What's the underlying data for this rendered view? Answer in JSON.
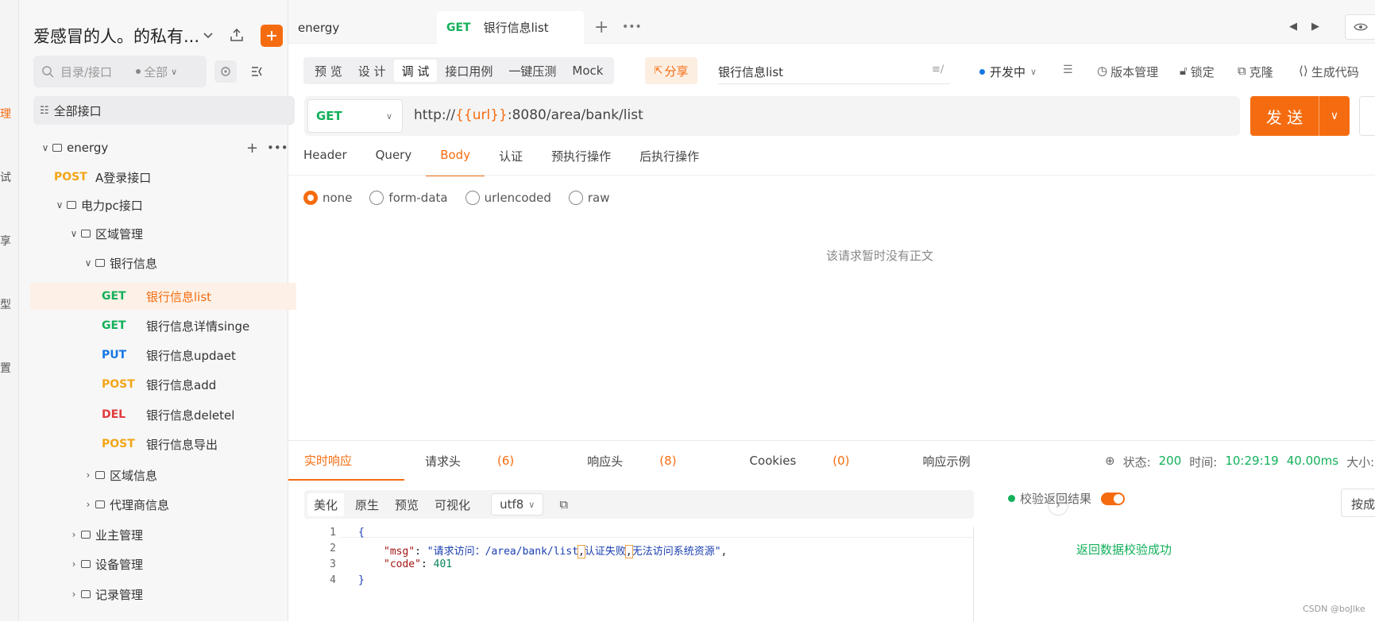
{
  "left_rail": {
    "items": [
      "理",
      "试",
      "享",
      "型",
      "置"
    ]
  },
  "sidebar": {
    "workspace": "爱感冒的人。的私有...",
    "search_placeholder": "目录/接口",
    "scope": "全部",
    "all_apis": "全部接口",
    "tree": [
      {
        "label": "energy",
        "type": "project"
      },
      {
        "method": "POST",
        "label": "A登录接口"
      },
      {
        "label": "电力pc接口",
        "type": "folder"
      },
      {
        "label": "区域管理",
        "type": "folder"
      },
      {
        "label": "银行信息",
        "type": "folder"
      },
      {
        "method": "GET",
        "label": "银行信息list",
        "selected": true
      },
      {
        "method": "GET",
        "label": "银行信息详情singe"
      },
      {
        "method": "PUT",
        "label": "银行信息updaet"
      },
      {
        "method": "POST",
        "label": "银行信息add"
      },
      {
        "method": "DEL",
        "label": "银行信息deletel"
      },
      {
        "method": "POST",
        "label": "银行信息导出"
      },
      {
        "label": "区域信息",
        "type": "folder"
      },
      {
        "label": "代理商信息",
        "type": "folder"
      },
      {
        "label": "业主管理",
        "type": "folder"
      },
      {
        "label": "设备管理",
        "type": "folder"
      },
      {
        "label": "记录管理",
        "type": "folder"
      }
    ]
  },
  "tabs": [
    {
      "label": "energy"
    },
    {
      "method": "GET",
      "label": "银行信息list",
      "active": true
    }
  ],
  "toolbar": {
    "modes": [
      "预 览",
      "设 计",
      "调 试",
      "接口用例",
      "一键压测",
      "Mock"
    ],
    "active_mode": "调 试",
    "share": "分享",
    "api_name": "银行信息list",
    "status": "开发中",
    "version": "版本管理",
    "lock": "锁定",
    "clone": "克隆",
    "gencode": "生成代码"
  },
  "request": {
    "method": "GET",
    "url_prefix": "http://",
    "url_var": "{{url}}",
    "url_suffix": ":8080/area/bank/list",
    "send": "发 送",
    "tabs": [
      "Header",
      "Query",
      "Body",
      "认证",
      "预执行操作",
      "后执行操作"
    ],
    "active_tab": "Body",
    "body_types": [
      "none",
      "form-data",
      "urlencoded",
      "raw"
    ],
    "body_selected": "none",
    "empty_body": "该请求暂时没有正文"
  },
  "response": {
    "tabs": [
      {
        "label": "实时响应",
        "count": ""
      },
      {
        "label": "请求头",
        "count": "(6)"
      },
      {
        "label": "响应头",
        "count": "(8)"
      },
      {
        "label": "Cookies",
        "count": "(0)"
      },
      {
        "label": "响应示例",
        "count": ""
      }
    ],
    "status_label": "状态:",
    "status_code": "200",
    "time_label": "时间:",
    "time_value": "10:29:19",
    "duration": "40.00ms",
    "size_label": "大小:",
    "formats": [
      "美化",
      "原生",
      "预览",
      "可视化"
    ],
    "encoding": "utf8",
    "code_lines": [
      "1",
      "2",
      "3",
      "4"
    ],
    "msg_key": "\"msg\"",
    "msg_value_a": "\"请求访问：/area/bank/list",
    "msg_value_b": "认证失败",
    "msg_value_c": "无法访问系统资源\"",
    "code_key": "\"code\"",
    "code_value": "401",
    "validate_label": "校验返回结果",
    "validate_result": "返回数据校验成功",
    "right_cut": "按成"
  },
  "watermark": "CSDN @boJlke",
  "colors": {
    "accent": "#f56c10",
    "get": "#13b05a",
    "post": "#f3a516",
    "put": "#1677e5",
    "del": "#e23b3b"
  }
}
